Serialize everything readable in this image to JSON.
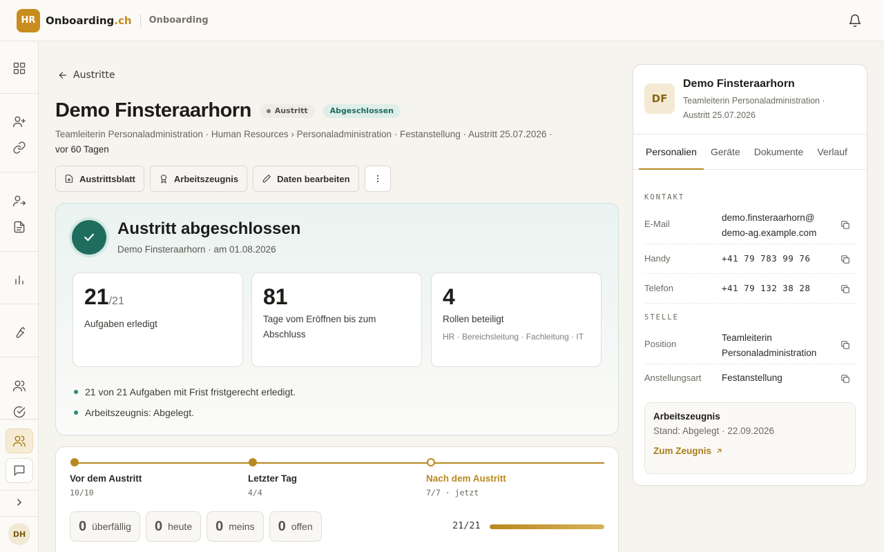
{
  "header": {
    "logo_text": "HR",
    "brand_name": "Onboarding",
    "brand_tld": ".ch",
    "section": "Onboarding",
    "icons": [
      "bell-icon"
    ]
  },
  "sidebar": {
    "icons": [
      "grid-icon",
      "user-plus-icon",
      "link-icon",
      "user-exit-icon",
      "document-icon",
      "bar-chart-icon",
      "wrench-icon",
      "users-icon",
      "check-circle-icon",
      "users-active-icon",
      "chat-icon",
      "chevron-right-icon"
    ],
    "avatar": "DH"
  },
  "page": {
    "back_label": "Austritte",
    "title": "Demo Finsteraarhorn",
    "status_gray": "Austritt",
    "status_green": "Abgeschlossen",
    "subtitle_line": "Teamleiterin Personaladministration · Human Resources › Personaladministration · Festanstellung · Austritt 25.07.2026 ·",
    "subtitle_ago": "vor 60 Tagen"
  },
  "actions": {
    "austrittsblatt": "Austrittsblatt",
    "arbeitszeugnis": "Arbeitszeugnis",
    "edit": "Daten bearbeiten"
  },
  "summary": {
    "title": "Austritt abgeschlossen",
    "subtitle": "Demo Finsteraarhorn · am 01.08.2026",
    "stats": [
      {
        "value": "21",
        "suffix": "/21",
        "label": "Aufgaben erledigt"
      },
      {
        "value": "81",
        "label": "Tage vom Eröffnen bis zum Abschluss"
      },
      {
        "value": "4",
        "label": "Rollen beteiligt",
        "detail": "HR · Bereichsleitung · Fachleitung · IT"
      }
    ],
    "bullets": [
      "21 von 21 Aufgaben mit Frist fristgerecht erledigt.",
      "Arbeitszeugnis: Abgelegt."
    ]
  },
  "phases": {
    "items": [
      {
        "name": "Vor dem Austritt",
        "count": "10/10"
      },
      {
        "name": "Letzter Tag",
        "count": "4/4"
      },
      {
        "name": "Nach dem Austritt",
        "count": "7/7 · jetzt"
      }
    ],
    "chips": [
      {
        "n": "0",
        "label": "überfällig"
      },
      {
        "n": "0",
        "label": "heute"
      },
      {
        "n": "0",
        "label": "meins"
      },
      {
        "n": "0",
        "label": "offen"
      }
    ],
    "progress_label": "21/21",
    "progress_fraction": 1.0
  },
  "panel": {
    "avatar": "DF",
    "name": "Demo Finsteraarhorn",
    "sub": "Teamleiterin Personaladministration · Austritt 25.07.2026",
    "tabs": [
      "Personalien",
      "Geräte",
      "Dokumente",
      "Verlauf"
    ],
    "section_kontakt": "KONTAKT",
    "section_stelle": "STELLE",
    "rows": {
      "email_label": "E-Mail",
      "email_value": "demo.finsteraarhorn@ demo-ag.example.com",
      "handy_label": "Handy",
      "handy_value": "+41 79 783 99 76",
      "telefon_label": "Telefon",
      "telefon_value": "+41 79 132 38 28",
      "position_label": "Position",
      "position_value": "Teamleiterin Personaladministration",
      "art_label": "Anstellungsart",
      "art_value": "Festanstellung"
    },
    "cert": {
      "title": "Arbeitszeugnis",
      "status": "Stand: Abgelegt · 22.09.2026",
      "link": "Zum Zeugnis"
    }
  },
  "colors": {
    "accent": "#b8891f",
    "success": "#1f6d5e",
    "logo": "#c98c1e"
  }
}
